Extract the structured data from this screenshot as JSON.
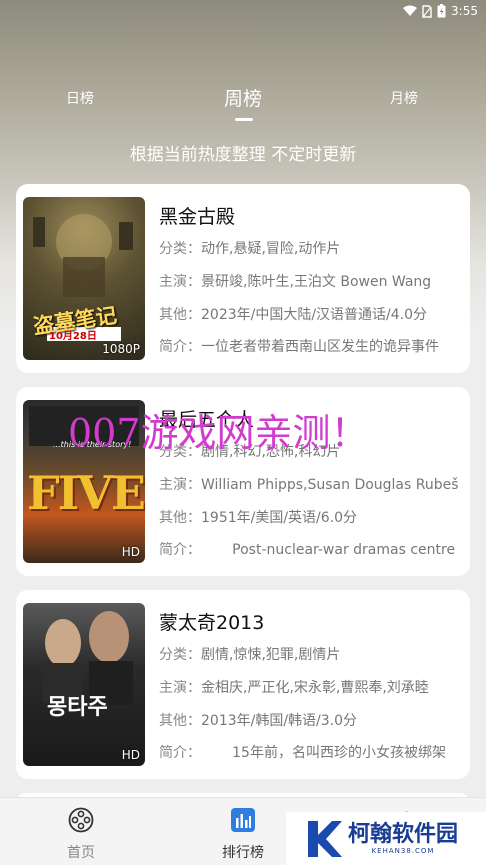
{
  "status_bar": {
    "time": "3:55"
  },
  "tabs": [
    {
      "label": "日榜",
      "active": false
    },
    {
      "label": "周榜",
      "active": true
    },
    {
      "label": "月榜",
      "active": false
    }
  ],
  "subtitle": "根据当前热度整理 不定时更新",
  "labels": {
    "category": "分类：",
    "cast": "主演：",
    "other": "其他：",
    "intro": "简介："
  },
  "movies": [
    {
      "title": "黑金古殿",
      "resolution": "1080P",
      "category": "动作,悬疑,冒险,动作片",
      "cast": "景研竣,陈叶生,王泊文 Bowen Wang",
      "other": "2023年/中国大陆/汉语普通话/4.0分",
      "intro": "一位老者带着西南山区发生的诡异事件",
      "poster_text": "盗墓笔记",
      "poster_date": "10月28日"
    },
    {
      "title": "最后五个人",
      "resolution": "HD",
      "category": "剧情,科幻,恐怖,科幻片",
      "cast": "William Phipps,Susan Douglas Rubeš",
      "other": "1951年/美国/英语/6.0分",
      "intro": "       Post-nuclear-war dramas centre",
      "poster_text": "FIVE",
      "poster_tagline": "...this is their story!"
    },
    {
      "title": "蒙太奇2013",
      "resolution": "HD",
      "category": "剧情,惊悚,犯罪,剧情片",
      "cast": "金相庆,严正化,宋永彰,曹熙奉,刘承睦",
      "other": "2013年/韩国/韩语/3.0分",
      "intro": "       15年前，名叫西珍的小女孩被绑架",
      "poster_text": "몽타주"
    }
  ],
  "watermark": "007游戏网亲测！",
  "bottom_nav": [
    {
      "label": "首页",
      "icon": "film-reel-icon",
      "active": false
    },
    {
      "label": "排行榜",
      "icon": "chart-icon",
      "active": true
    }
  ],
  "kehan": {
    "name": "柯翰软件园",
    "domain": "KEHAN38.COM"
  }
}
